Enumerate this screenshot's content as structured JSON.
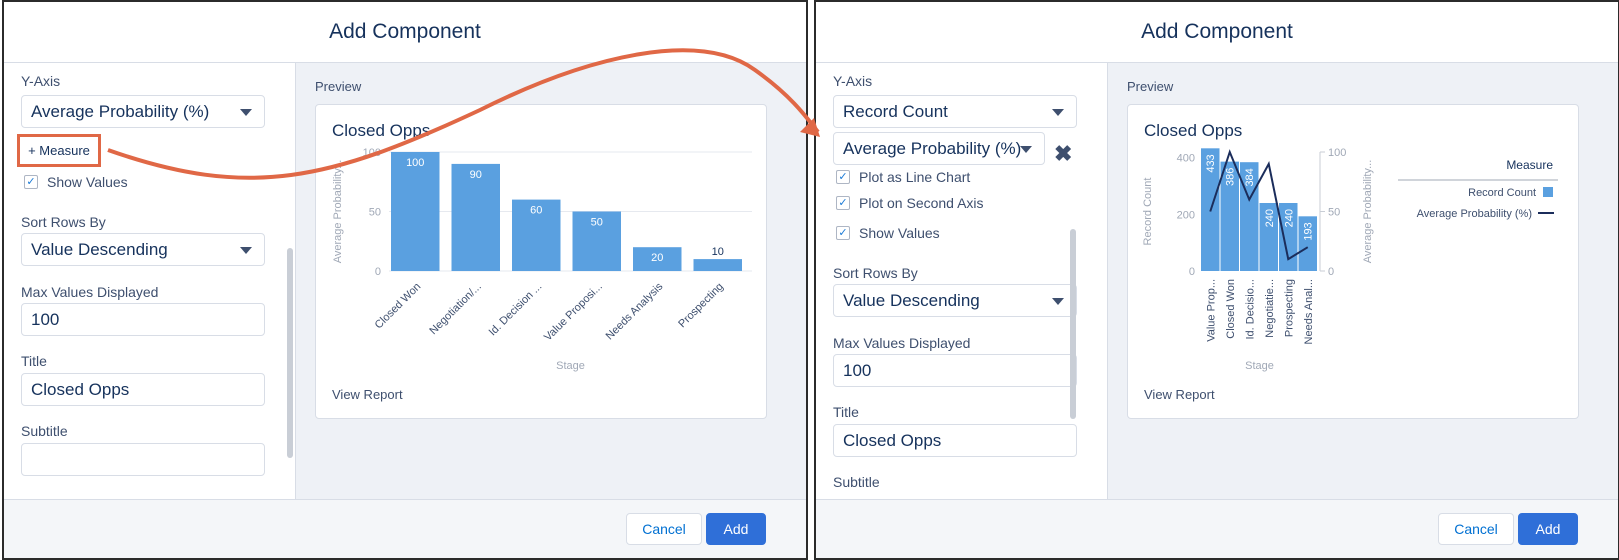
{
  "colors": {
    "accent": "#e06846",
    "bar": "#5aa0e0",
    "brand_button": "#2f6fd8",
    "line": "#1b2d5b"
  },
  "left": {
    "header": "Add Component",
    "y_axis_label": "Y-Axis",
    "y_axis_value": "Average Probability (%)",
    "measure_button": "+ Measure",
    "show_values": "Show Values",
    "sort_label": "Sort Rows By",
    "sort_value": "Value Descending",
    "max_label": "Max Values Displayed",
    "max_value": "100",
    "title_label": "Title",
    "title_value": "Closed Opps",
    "subtitle_label": "Subtitle",
    "subtitle_value": "",
    "preview_label": "Preview",
    "card_title": "Closed Opps",
    "view_report": "View Report",
    "cancel": "Cancel",
    "add": "Add"
  },
  "right": {
    "header": "Add Component",
    "y_axis_label": "Y-Axis",
    "y_axis_value": "Record Count",
    "measure2_value": "Average Probability (%)",
    "plot_line": "Plot as Line Chart",
    "plot_second": "Plot on Second Axis",
    "show_values": "Show Values",
    "sort_label": "Sort Rows By",
    "sort_value": "Value Descending",
    "max_label": "Max Values Displayed",
    "max_value": "100",
    "title_label": "Title",
    "title_value": "Closed Opps",
    "subtitle_label": "Subtitle",
    "preview_label": "Preview",
    "card_title": "Closed Opps",
    "view_report": "View Report",
    "cancel": "Cancel",
    "add": "Add"
  },
  "chart_data": [
    {
      "type": "bar",
      "title": "Closed Opps",
      "xlabel": "Stage",
      "ylabel": "Average Probability...",
      "categories": [
        "Closed Won",
        "Negotiation/...",
        "Id. Decision ...",
        "Value Proposi...",
        "Needs Analysis",
        "Prospecting"
      ],
      "values": [
        100,
        90,
        60,
        50,
        20,
        10
      ],
      "ylim": [
        0,
        100
      ],
      "yticks": [
        0,
        50,
        100
      ],
      "data_labels": true
    },
    {
      "type": "bar",
      "title": "Closed Opps",
      "xlabel": "Stage",
      "ylabel": "Record Count",
      "y2label": "Average Probability...",
      "categories": [
        "Value Prop...",
        "Closed Won",
        "Id. Decisio...",
        "Negotiatie...",
        "Prospecting",
        "Needs Anal..."
      ],
      "series": [
        {
          "name": "Record Count",
          "type": "bar",
          "axis": "left",
          "values": [
            433,
            386,
            384,
            240,
            240,
            193
          ]
        },
        {
          "name": "Average Probability (%)",
          "type": "line",
          "axis": "right",
          "values": [
            50,
            100,
            60,
            90,
            10,
            20
          ]
        }
      ],
      "ylim": [
        0,
        420
      ],
      "yticks": [
        0,
        200,
        400
      ],
      "y2lim": [
        0,
        100
      ],
      "y2ticks": [
        0,
        50,
        100
      ],
      "legend_title": "Measure",
      "legend_position": "right"
    }
  ]
}
